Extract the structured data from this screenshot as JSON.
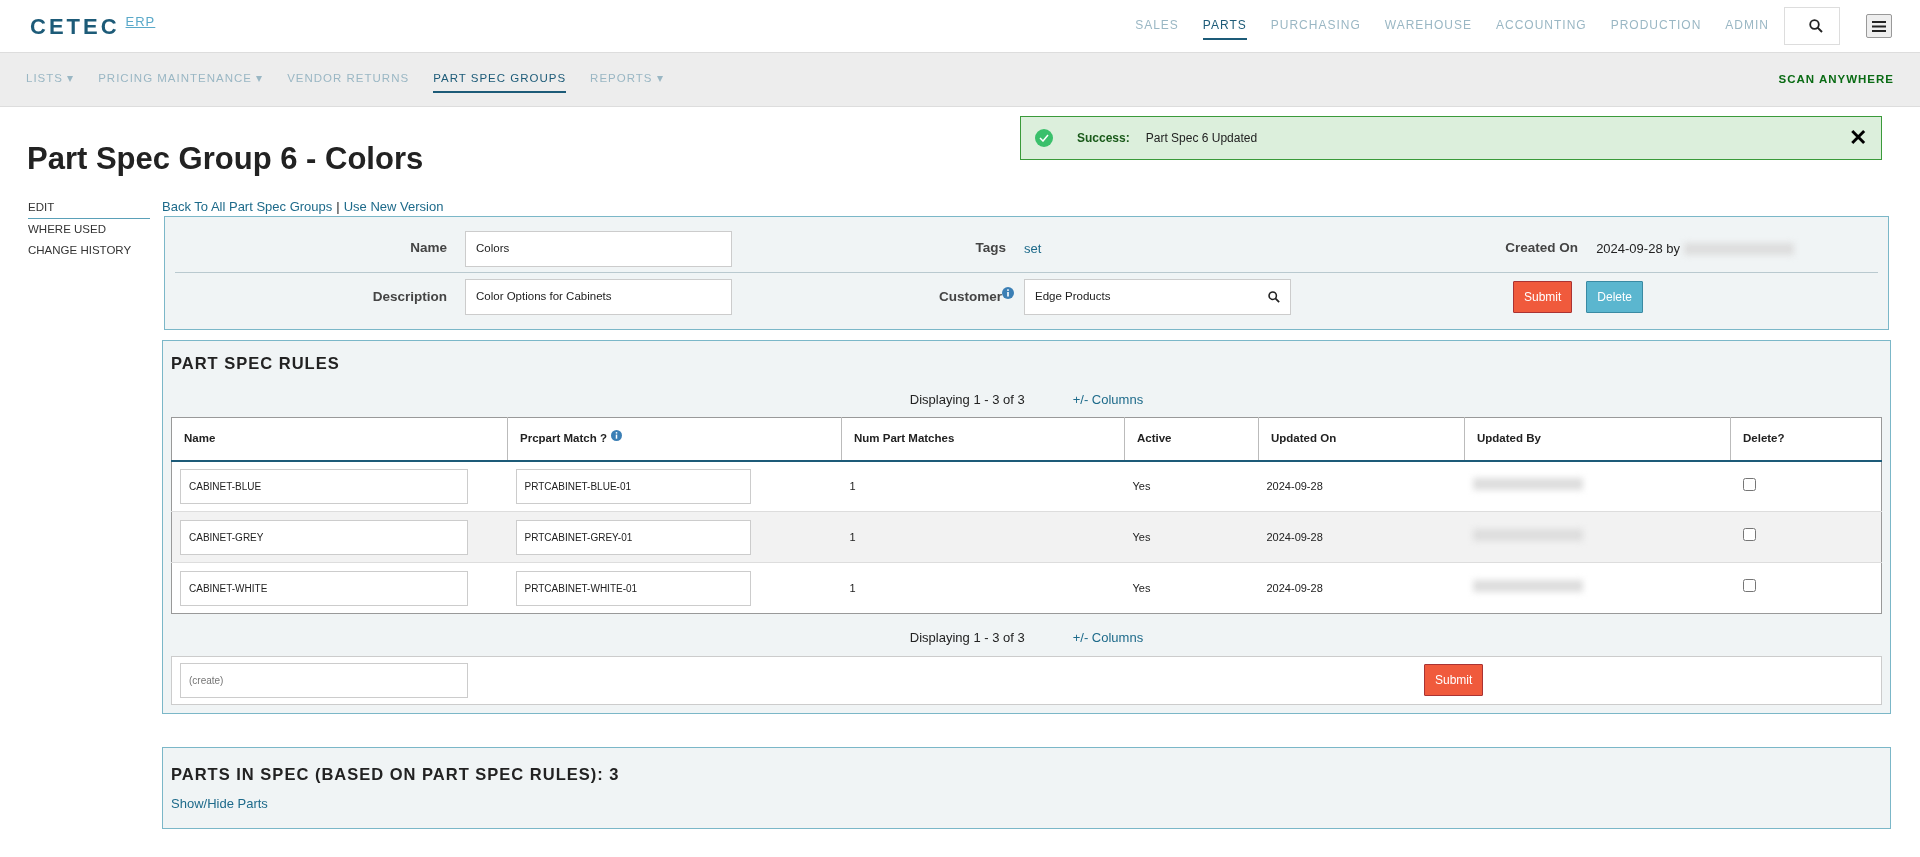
{
  "brand": {
    "name": "CETEC",
    "suffix": "ERP"
  },
  "top_nav": [
    {
      "label": "SALES",
      "selected": false
    },
    {
      "label": "PARTS",
      "selected": true
    },
    {
      "label": "PURCHASING",
      "selected": false
    },
    {
      "label": "WAREHOUSE",
      "selected": false
    },
    {
      "label": "ACCOUNTING",
      "selected": false
    },
    {
      "label": "PRODUCTION",
      "selected": false
    },
    {
      "label": "ADMIN",
      "selected": false
    }
  ],
  "sub_nav": [
    {
      "label": "LISTS ▾",
      "selected": false
    },
    {
      "label": "PRICING MAINTENANCE ▾",
      "selected": false
    },
    {
      "label": "VENDOR RETURNS",
      "selected": false
    },
    {
      "label": "PART SPEC GROUPS",
      "selected": true
    },
    {
      "label": "REPORTS ▾",
      "selected": false
    }
  ],
  "scan_link": "SCAN ANYWHERE",
  "alert": {
    "title": "Success:",
    "message": "Part Spec 6 Updated",
    "close": "✕"
  },
  "page_title": "Part Spec Group 6 - Colors",
  "side_menu": [
    {
      "label": "EDIT",
      "selected": true
    },
    {
      "label": "WHERE USED",
      "selected": false
    },
    {
      "label": "CHANGE HISTORY",
      "selected": false
    }
  ],
  "links": [
    "Back To All Part Spec Groups",
    "Use New Version"
  ],
  "link_separator": "|",
  "form": {
    "name_label": "Name",
    "name_value": "Colors",
    "tags_label": "Tags",
    "tags_link": "set",
    "created_label": "Created On",
    "created_value": "2024-09-28 by",
    "description_label": "Description",
    "description_value": "Color Options for Cabinets",
    "customer_label": "Customer",
    "customer_value": "Edge Products",
    "submit": "Submit",
    "delete": "Delete"
  },
  "rules": {
    "title": "PART SPEC RULES",
    "displaying": "Displaying 1 - 3 of 3",
    "columns_link": "+/- Columns",
    "columns": [
      "Name",
      "Prcpart Match ?",
      "Num Part Matches",
      "Active",
      "Updated On",
      "Updated By",
      "Delete?"
    ],
    "rows": [
      {
        "name": "CABINET-BLUE",
        "match": "PRTCABINET-BLUE-01",
        "num": "1",
        "active": "Yes",
        "updated_on": "2024-09-28",
        "checked": false
      },
      {
        "name": "CABINET-GREY",
        "match": "PRTCABINET-GREY-01",
        "num": "1",
        "active": "Yes",
        "updated_on": "2024-09-28",
        "checked": false
      },
      {
        "name": "CABINET-WHITE",
        "match": "PRTCABINET-WHITE-01",
        "num": "1",
        "active": "Yes",
        "updated_on": "2024-09-28",
        "checked": false
      }
    ],
    "displaying_bottom": "Displaying 1 - 3 of 3",
    "columns_link_bottom": "+/- Columns",
    "create_placeholder": "(create)",
    "submit": "Submit"
  },
  "parts": {
    "title": "PARTS IN SPEC (BASED ON PART SPEC RULES): 3",
    "toggle": "Show/Hide Parts"
  }
}
